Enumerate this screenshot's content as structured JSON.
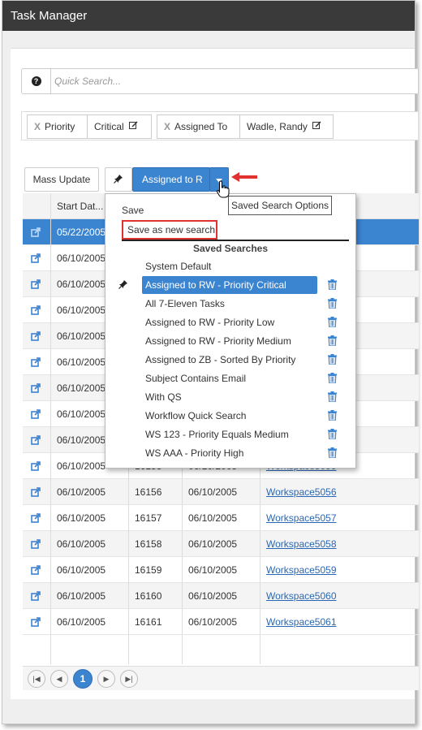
{
  "window": {
    "title": "Task Manager"
  },
  "search": {
    "placeholder": "Quick Search...",
    "help_icon": "question-circle-icon"
  },
  "filters": [
    {
      "field": "Priority",
      "value": "Critical"
    },
    {
      "field": "Assigned To",
      "value": "Wadle, Randy"
    }
  ],
  "toolbar": {
    "mass_update_label": "Mass Update",
    "saved_search_label": "Assigned to R",
    "tooltip": "Saved Search Options"
  },
  "dropdown": {
    "save_label": "Save",
    "save_as_new_label": "Save as new search",
    "section_title": "Saved Searches",
    "items": [
      {
        "label": "System Default",
        "pinned": false,
        "deletable": false,
        "active": false
      },
      {
        "label": "Assigned to RW - Priority Critical",
        "pinned": true,
        "deletable": true,
        "active": true
      },
      {
        "label": "All 7-Eleven Tasks",
        "pinned": false,
        "deletable": true,
        "active": false
      },
      {
        "label": "Assigned to RW - Priority Low",
        "pinned": false,
        "deletable": true,
        "active": false
      },
      {
        "label": "Assigned to RW - Priority Medium",
        "pinned": false,
        "deletable": true,
        "active": false
      },
      {
        "label": "Assigned to ZB - Sorted By Priority",
        "pinned": false,
        "deletable": true,
        "active": false
      },
      {
        "label": "Subject Contains Email",
        "pinned": false,
        "deletable": true,
        "active": false
      },
      {
        "label": "With QS",
        "pinned": false,
        "deletable": true,
        "active": false
      },
      {
        "label": "Workflow Quick Search",
        "pinned": false,
        "deletable": true,
        "active": false
      },
      {
        "label": "WS 123 - Priority Equals Medium",
        "pinned": false,
        "deletable": true,
        "active": false
      },
      {
        "label": "WS AAA - Priority High",
        "pinned": false,
        "deletable": true,
        "active": false
      }
    ]
  },
  "grid": {
    "header": {
      "start_date": "Start Dat..."
    },
    "rows": [
      {
        "start": "05/22/2005",
        "id": "",
        "date": "",
        "workspace": "",
        "selected": true
      },
      {
        "start": "06/10/2005",
        "id": "",
        "date": "",
        "workspace": ""
      },
      {
        "start": "06/10/2005",
        "id": "",
        "date": "",
        "workspace": ""
      },
      {
        "start": "06/10/2005",
        "id": "",
        "date": "",
        "workspace": ""
      },
      {
        "start": "06/10/2005",
        "id": "",
        "date": "",
        "workspace": ""
      },
      {
        "start": "06/10/2005",
        "id": "",
        "date": "",
        "workspace": ""
      },
      {
        "start": "06/10/2005",
        "id": "",
        "date": "",
        "workspace": ""
      },
      {
        "start": "06/10/2005",
        "id": "",
        "date": "",
        "workspace": ""
      },
      {
        "start": "06/10/2005",
        "id": "",
        "date": "",
        "workspace": ""
      },
      {
        "start": "06/10/2005",
        "id": "16155",
        "date": "06/10/2005",
        "workspace": "Workspace5055"
      },
      {
        "start": "06/10/2005",
        "id": "16156",
        "date": "06/10/2005",
        "workspace": "Workspace5056"
      },
      {
        "start": "06/10/2005",
        "id": "16157",
        "date": "06/10/2005",
        "workspace": "Workspace5057"
      },
      {
        "start": "06/10/2005",
        "id": "16158",
        "date": "06/10/2005",
        "workspace": "Workspace5058"
      },
      {
        "start": "06/10/2005",
        "id": "16159",
        "date": "06/10/2005",
        "workspace": "Workspace5059"
      },
      {
        "start": "06/10/2005",
        "id": "16160",
        "date": "06/10/2005",
        "workspace": "Workspace5060"
      },
      {
        "start": "06/10/2005",
        "id": "16161",
        "date": "06/10/2005",
        "workspace": "Workspace5061"
      }
    ]
  },
  "pager": {
    "current_page": "1"
  },
  "colors": {
    "accent": "#3b84d0",
    "highlight": "#e0322f",
    "titlebar": "#3a3a3a"
  }
}
